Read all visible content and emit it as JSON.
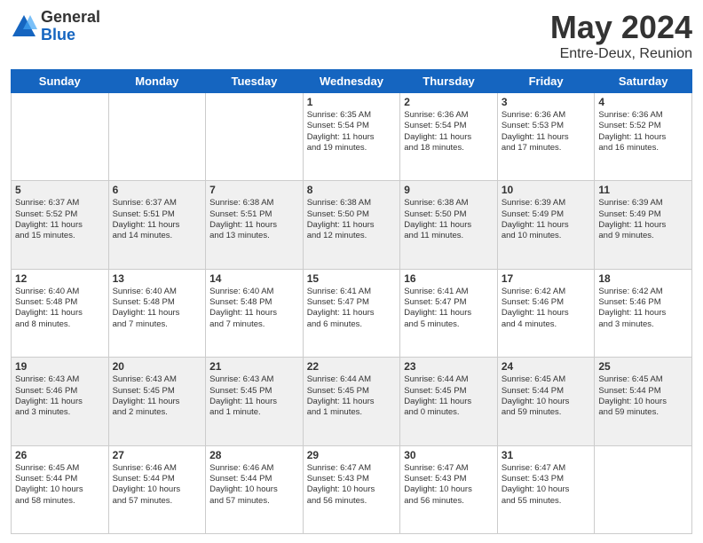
{
  "logo": {
    "general": "General",
    "blue": "Blue"
  },
  "title": "May 2024",
  "subtitle": "Entre-Deux, Reunion",
  "headers": [
    "Sunday",
    "Monday",
    "Tuesday",
    "Wednesday",
    "Thursday",
    "Friday",
    "Saturday"
  ],
  "weeks": [
    [
      {
        "day": "",
        "info": ""
      },
      {
        "day": "",
        "info": ""
      },
      {
        "day": "",
        "info": ""
      },
      {
        "day": "1",
        "info": "Sunrise: 6:35 AM\nSunset: 5:54 PM\nDaylight: 11 hours\nand 19 minutes."
      },
      {
        "day": "2",
        "info": "Sunrise: 6:36 AM\nSunset: 5:54 PM\nDaylight: 11 hours\nand 18 minutes."
      },
      {
        "day": "3",
        "info": "Sunrise: 6:36 AM\nSunset: 5:53 PM\nDaylight: 11 hours\nand 17 minutes."
      },
      {
        "day": "4",
        "info": "Sunrise: 6:36 AM\nSunset: 5:52 PM\nDaylight: 11 hours\nand 16 minutes."
      }
    ],
    [
      {
        "day": "5",
        "info": "Sunrise: 6:37 AM\nSunset: 5:52 PM\nDaylight: 11 hours\nand 15 minutes."
      },
      {
        "day": "6",
        "info": "Sunrise: 6:37 AM\nSunset: 5:51 PM\nDaylight: 11 hours\nand 14 minutes."
      },
      {
        "day": "7",
        "info": "Sunrise: 6:38 AM\nSunset: 5:51 PM\nDaylight: 11 hours\nand 13 minutes."
      },
      {
        "day": "8",
        "info": "Sunrise: 6:38 AM\nSunset: 5:50 PM\nDaylight: 11 hours\nand 12 minutes."
      },
      {
        "day": "9",
        "info": "Sunrise: 6:38 AM\nSunset: 5:50 PM\nDaylight: 11 hours\nand 11 minutes."
      },
      {
        "day": "10",
        "info": "Sunrise: 6:39 AM\nSunset: 5:49 PM\nDaylight: 11 hours\nand 10 minutes."
      },
      {
        "day": "11",
        "info": "Sunrise: 6:39 AM\nSunset: 5:49 PM\nDaylight: 11 hours\nand 9 minutes."
      }
    ],
    [
      {
        "day": "12",
        "info": "Sunrise: 6:40 AM\nSunset: 5:48 PM\nDaylight: 11 hours\nand 8 minutes."
      },
      {
        "day": "13",
        "info": "Sunrise: 6:40 AM\nSunset: 5:48 PM\nDaylight: 11 hours\nand 7 minutes."
      },
      {
        "day": "14",
        "info": "Sunrise: 6:40 AM\nSunset: 5:48 PM\nDaylight: 11 hours\nand 7 minutes."
      },
      {
        "day": "15",
        "info": "Sunrise: 6:41 AM\nSunset: 5:47 PM\nDaylight: 11 hours\nand 6 minutes."
      },
      {
        "day": "16",
        "info": "Sunrise: 6:41 AM\nSunset: 5:47 PM\nDaylight: 11 hours\nand 5 minutes."
      },
      {
        "day": "17",
        "info": "Sunrise: 6:42 AM\nSunset: 5:46 PM\nDaylight: 11 hours\nand 4 minutes."
      },
      {
        "day": "18",
        "info": "Sunrise: 6:42 AM\nSunset: 5:46 PM\nDaylight: 11 hours\nand 3 minutes."
      }
    ],
    [
      {
        "day": "19",
        "info": "Sunrise: 6:43 AM\nSunset: 5:46 PM\nDaylight: 11 hours\nand 3 minutes."
      },
      {
        "day": "20",
        "info": "Sunrise: 6:43 AM\nSunset: 5:45 PM\nDaylight: 11 hours\nand 2 minutes."
      },
      {
        "day": "21",
        "info": "Sunrise: 6:43 AM\nSunset: 5:45 PM\nDaylight: 11 hours\nand 1 minute."
      },
      {
        "day": "22",
        "info": "Sunrise: 6:44 AM\nSunset: 5:45 PM\nDaylight: 11 hours\nand 1 minutes."
      },
      {
        "day": "23",
        "info": "Sunrise: 6:44 AM\nSunset: 5:45 PM\nDaylight: 11 hours\nand 0 minutes."
      },
      {
        "day": "24",
        "info": "Sunrise: 6:45 AM\nSunset: 5:44 PM\nDaylight: 10 hours\nand 59 minutes."
      },
      {
        "day": "25",
        "info": "Sunrise: 6:45 AM\nSunset: 5:44 PM\nDaylight: 10 hours\nand 59 minutes."
      }
    ],
    [
      {
        "day": "26",
        "info": "Sunrise: 6:45 AM\nSunset: 5:44 PM\nDaylight: 10 hours\nand 58 minutes."
      },
      {
        "day": "27",
        "info": "Sunrise: 6:46 AM\nSunset: 5:44 PM\nDaylight: 10 hours\nand 57 minutes."
      },
      {
        "day": "28",
        "info": "Sunrise: 6:46 AM\nSunset: 5:44 PM\nDaylight: 10 hours\nand 57 minutes."
      },
      {
        "day": "29",
        "info": "Sunrise: 6:47 AM\nSunset: 5:43 PM\nDaylight: 10 hours\nand 56 minutes."
      },
      {
        "day": "30",
        "info": "Sunrise: 6:47 AM\nSunset: 5:43 PM\nDaylight: 10 hours\nand 56 minutes."
      },
      {
        "day": "31",
        "info": "Sunrise: 6:47 AM\nSunset: 5:43 PM\nDaylight: 10 hours\nand 55 minutes."
      },
      {
        "day": "",
        "info": ""
      }
    ]
  ]
}
